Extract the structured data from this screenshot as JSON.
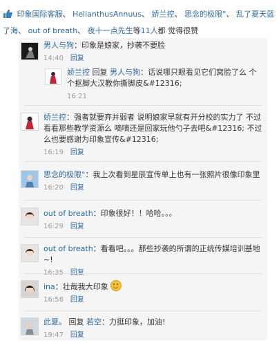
{
  "likes": {
    "users": [
      "印象国际客服",
      "HelianthusAnnuus",
      "娇兰控",
      "思念的极限°",
      "乱了夏天蓝了海",
      "out of breath",
      "夜十一点先生"
    ],
    "count_prefix": "等",
    "count": "11人",
    "suffix": "都 觉得很赞",
    "separator": "、"
  },
  "comments": [
    {
      "author": "男人与狗",
      "text": "：印象是娘家，抄袭不要脸",
      "time": "14:40",
      "reply_label": "回复",
      "avatar_icon": "dark-figure-avatar",
      "nested_reply": {
        "author": "娇兰控",
        "reply_word": "回复",
        "target": "男人与狗",
        "text": "：话说哪只眼看见它们窝脸了么 个个抠脚大汉教你撕脚皮&#12316;",
        "time": "16:21",
        "avatar_icon": "red-dress-avatar"
      }
    },
    {
      "author": "娇兰控",
      "text": "：强者就要弃并弱者 说明娘家早就有开分校的实力了 不过看看那些教学资源么 嘀嘀还是回家玩他勺子去吧&#12316; 不过么也要感谢为印象宣传&#12316;",
      "time": "16:19",
      "reply_label": "回复",
      "avatar_icon": "red-dress-avatar"
    },
    {
      "author": "思念的极限°",
      "text": "：我上次看到星辰宣传单上也有一张照片很像印象里",
      "time": "16:20",
      "reply_label": "回复",
      "avatar_icon": "blue-portrait-avatar"
    },
    {
      "author": "out of breath",
      "text": "：印象很好！！哈哈。。。",
      "time": "16:29",
      "reply_label": "回复",
      "avatar_icon": "girl-portrait-avatar"
    },
    {
      "author": "out of breath",
      "text": "：看看吧。。。那些抄袭的所谓的正统传媒培训基地~!",
      "time": "16:35",
      "reply_label": "回复",
      "avatar_icon": "girl-portrait-avatar"
    },
    {
      "author": "ina",
      "text": "：壮哉我大印象",
      "emoji": "smile-emoji",
      "time": "16:58",
      "reply_label": "回复",
      "avatar_icon": "dark-hair-avatar"
    },
    {
      "author": "此夏。",
      "reply_word": "回复",
      "target": "若空",
      "text": "：力挺印象，加油!",
      "time": "19:47",
      "reply_label": "回复",
      "avatar_icon": "person-avatar"
    }
  ]
}
